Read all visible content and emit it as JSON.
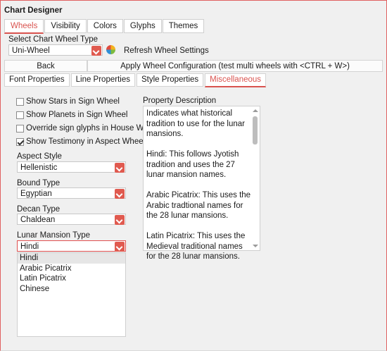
{
  "window": {
    "title": "Chart Designer"
  },
  "top_tabs": [
    "Wheels",
    "Visibility",
    "Colors",
    "Glyphs",
    "Themes"
  ],
  "wheel_type": {
    "label": "Select Chart Wheel Type",
    "value": "Uni-Wheel",
    "refresh_label": "Refresh Wheel Settings"
  },
  "toolbar": {
    "back_label": "Back",
    "apply_label": "Apply Wheel Configuration (test multi wheels with <CTRL + W>)"
  },
  "sub_tabs": [
    "Font Properties",
    "Line Properties",
    "Style Properties",
    "Miscellaneous"
  ],
  "checkboxes": [
    {
      "label": "Show Stars in Sign Wheel",
      "checked": false
    },
    {
      "label": "Show Planets in Sign Wheel",
      "checked": false
    },
    {
      "label": "Override sign glyphs in House Wheel",
      "checked": false
    },
    {
      "label": "Show Testimony in Aspect Wheel",
      "checked": true
    }
  ],
  "aspect_style": {
    "label": "Aspect Style",
    "value": "Hellenistic"
  },
  "bound_type": {
    "label": "Bound Type",
    "value": "Egyptian"
  },
  "decan_type": {
    "label": "Decan Type",
    "value": "Chaldean"
  },
  "lunar_mansion": {
    "label": "Lunar Mansion Type",
    "value": "Hindi",
    "options": [
      "Hindi",
      "Arabic Picatrix",
      "Latin Picatrix",
      "Chinese"
    ]
  },
  "property_description": {
    "label": "Property Description",
    "text": "Indicates what historical tradition to use for the lunar mansions.\n\nHindi: This follows Jyotish tradition and uses the 27 lunar mansion names.\n\nArabic Picatrix: This uses the Arabic tradtional names for the 28 lunar mansions.\n\nLatin Picatrix: This uses the Medieval traditional names for the 28 lunar mansions."
  },
  "colors": {
    "accent": "#e05a4f",
    "active_tab_text": "#d9534f"
  },
  "icons": {
    "refresh": "refresh-wheel-icon",
    "dropdown": "chevron-down-icon"
  }
}
